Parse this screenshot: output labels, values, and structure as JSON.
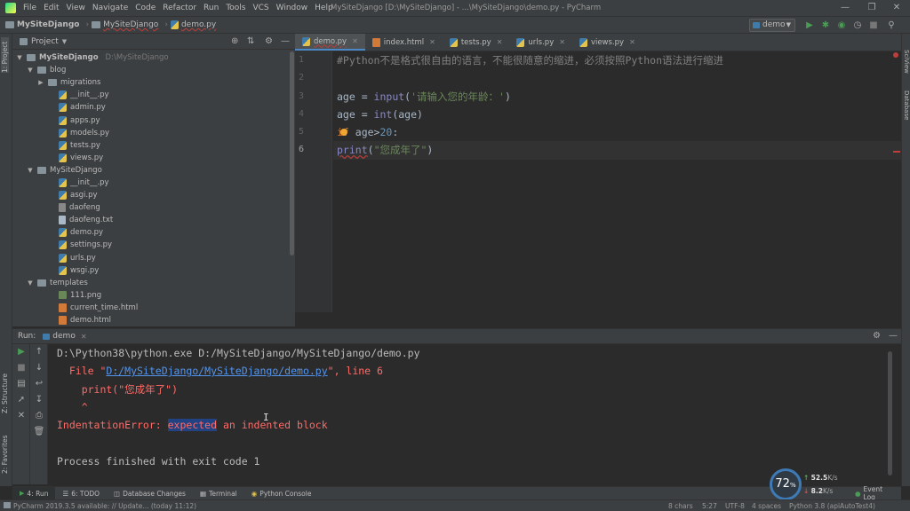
{
  "menu": [
    "File",
    "Edit",
    "View",
    "Navigate",
    "Code",
    "Refactor",
    "Run",
    "Tools",
    "VCS",
    "Window",
    "Help"
  ],
  "window_title": "MySiteDjango [D:\\MySiteDjango] - ...\\MySiteDjango\\demo.py - PyCharm",
  "breadcrumb": [
    "MySiteDjango",
    "MySiteDjango",
    "demo.py"
  ],
  "run_config": "demo",
  "left_strip": {
    "project": "1: Project",
    "structure": "Z: Structure",
    "favorites": "2: Favorites"
  },
  "right_strip": {
    "scview": "SciView",
    "database": "Database"
  },
  "project_panel": {
    "title": "Project",
    "tree": [
      {
        "label": "MySiteDjango",
        "hint": "D:\\MySiteDjango",
        "indent": 0,
        "arrow": "▼",
        "icon": "folder",
        "bold": true
      },
      {
        "label": "blog",
        "indent": 1,
        "arrow": "▼",
        "icon": "folder"
      },
      {
        "label": "migrations",
        "indent": 2,
        "arrow": "▶",
        "icon": "folder"
      },
      {
        "label": "__init__.py",
        "indent": 3,
        "icon": "py"
      },
      {
        "label": "admin.py",
        "indent": 3,
        "icon": "py"
      },
      {
        "label": "apps.py",
        "indent": 3,
        "icon": "py"
      },
      {
        "label": "models.py",
        "indent": 3,
        "icon": "py"
      },
      {
        "label": "tests.py",
        "indent": 3,
        "icon": "py"
      },
      {
        "label": "views.py",
        "indent": 3,
        "icon": "py"
      },
      {
        "label": "MySiteDjango",
        "indent": 1,
        "arrow": "▼",
        "icon": "folder"
      },
      {
        "label": "__init__.py",
        "indent": 3,
        "icon": "py"
      },
      {
        "label": "asgi.py",
        "indent": 3,
        "icon": "py"
      },
      {
        "label": "daofeng",
        "indent": 3,
        "icon": "gen"
      },
      {
        "label": "daofeng.txt",
        "indent": 3,
        "icon": "txt"
      },
      {
        "label": "demo.py",
        "indent": 3,
        "icon": "py"
      },
      {
        "label": "settings.py",
        "indent": 3,
        "icon": "py"
      },
      {
        "label": "urls.py",
        "indent": 3,
        "icon": "py"
      },
      {
        "label": "wsgi.py",
        "indent": 3,
        "icon": "py"
      },
      {
        "label": "templates",
        "indent": 1,
        "arrow": "▼",
        "icon": "folder"
      },
      {
        "label": "111.png",
        "indent": 3,
        "icon": "png"
      },
      {
        "label": "current_time.html",
        "indent": 3,
        "icon": "html"
      },
      {
        "label": "demo.html",
        "indent": 3,
        "icon": "html"
      }
    ]
  },
  "editor": {
    "tabs": [
      {
        "label": "demo.py",
        "icon": "py",
        "active": true
      },
      {
        "label": "index.html",
        "icon": "html"
      },
      {
        "label": "tests.py",
        "icon": "py"
      },
      {
        "label": "urls.py",
        "icon": "py"
      },
      {
        "label": "views.py",
        "icon": "py"
      }
    ],
    "line_numbers": [
      "1",
      "2",
      "3",
      "4",
      "5",
      "6"
    ],
    "code": {
      "l1_comment": "#Python不是格式很自由的语言，不能很随意的缩进，必须按照Python语法进行缩进",
      "l3_var": "age = ",
      "l3_fn": "input",
      "l3_open": "(",
      "l3_str": "'请输入您的年龄：'",
      "l3_close": ")",
      "l4_a": "age = ",
      "l4_fn": "int",
      "l4_b": "(age)",
      "l5_kw": "if",
      "l5_a": " age>",
      "l5_num": "20",
      "l5_b": ":",
      "l6_fn": "print",
      "l6_open": "(",
      "l6_str": "\"您成年了\"",
      "l6_close": ")"
    }
  },
  "run_panel": {
    "label": "Run:",
    "tab": "demo",
    "console": {
      "cmd": "D:\\Python38\\python.exe D:/MySiteDjango/MySiteDjango/demo.py",
      "file_prefix": "  File \"",
      "file_link": "D:/MySiteDjango/MySiteDjango/demo.py",
      "file_suffix": "\", line 6",
      "code_line": "    print(\"您成年了\")",
      "caret": "    ^",
      "err_a": "IndentationError: ",
      "err_hl": "expected",
      "err_b": " an indented block",
      "finished": "Process finished with exit code 1"
    }
  },
  "tool_tabs": [
    "4: Run",
    "6: TODO",
    "Database Changes",
    "Terminal",
    "Python Console"
  ],
  "event_log": "Event Log",
  "status": {
    "message": "PyCharm 2019.3.5 available: // Update... (today 11:12)",
    "chars": "8 chars",
    "position": "5:27",
    "encoding": "UTF-8",
    "indent": "4 spaces",
    "interpreter": "Python 3.8 (apiAutoTest4)"
  },
  "net_widget": {
    "percent": "72",
    "unit": "%",
    "up": "52.5",
    "up_unit": "K/s",
    "down": "8.2",
    "down_unit": "K/s"
  },
  "colors": {
    "accent": "#4a88c7",
    "run_green": "#499c54",
    "error_red": "#ff6b68",
    "link_blue": "#5394ec"
  }
}
